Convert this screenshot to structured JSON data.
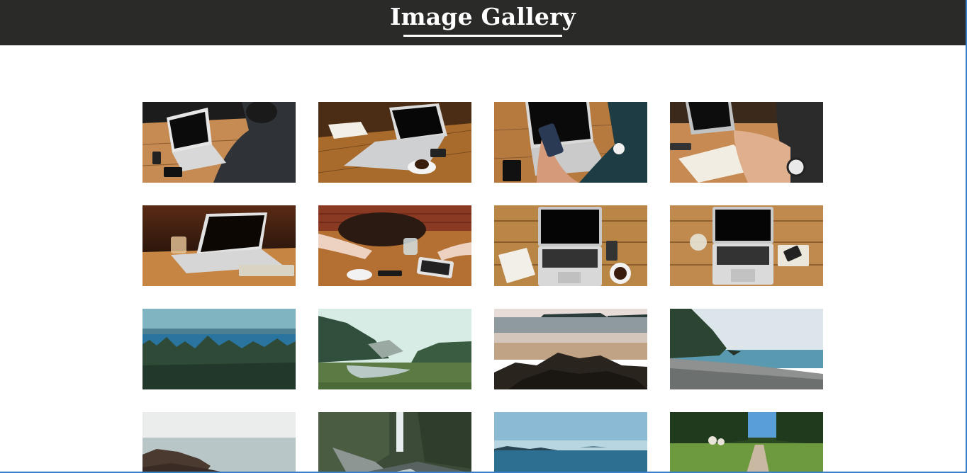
{
  "header": {
    "title": "Image Gallery"
  },
  "gallery": {
    "images": [
      {
        "name": "image-laptop-typing-desk",
        "scene": "laptop"
      },
      {
        "name": "image-laptop-notebook-coffee",
        "scene": "laptop"
      },
      {
        "name": "image-hand-phone-laptop",
        "scene": "laptop"
      },
      {
        "name": "image-writing-notebook-watch",
        "scene": "laptop"
      },
      {
        "name": "image-laptop-on-table",
        "scene": "laptop"
      },
      {
        "name": "image-meeting-bag-tablet",
        "scene": "laptop"
      },
      {
        "name": "image-laptop-topdown-coffee",
        "scene": "laptop"
      },
      {
        "name": "image-laptop-topdown-glass",
        "scene": "laptop"
      },
      {
        "name": "image-forest-lake-view",
        "scene": "forest-lake"
      },
      {
        "name": "image-valley-river-mist",
        "scene": "valley"
      },
      {
        "name": "image-beach-rocks",
        "scene": "beach"
      },
      {
        "name": "image-rocky-shore-trees",
        "scene": "shore"
      },
      {
        "name": "image-sea-rocks-fog",
        "scene": "sea-rocks"
      },
      {
        "name": "image-waterfall-canyon",
        "scene": "waterfall"
      },
      {
        "name": "image-calm-sea-horizon",
        "scene": "sea"
      },
      {
        "name": "image-forest-path",
        "scene": "path"
      }
    ]
  }
}
